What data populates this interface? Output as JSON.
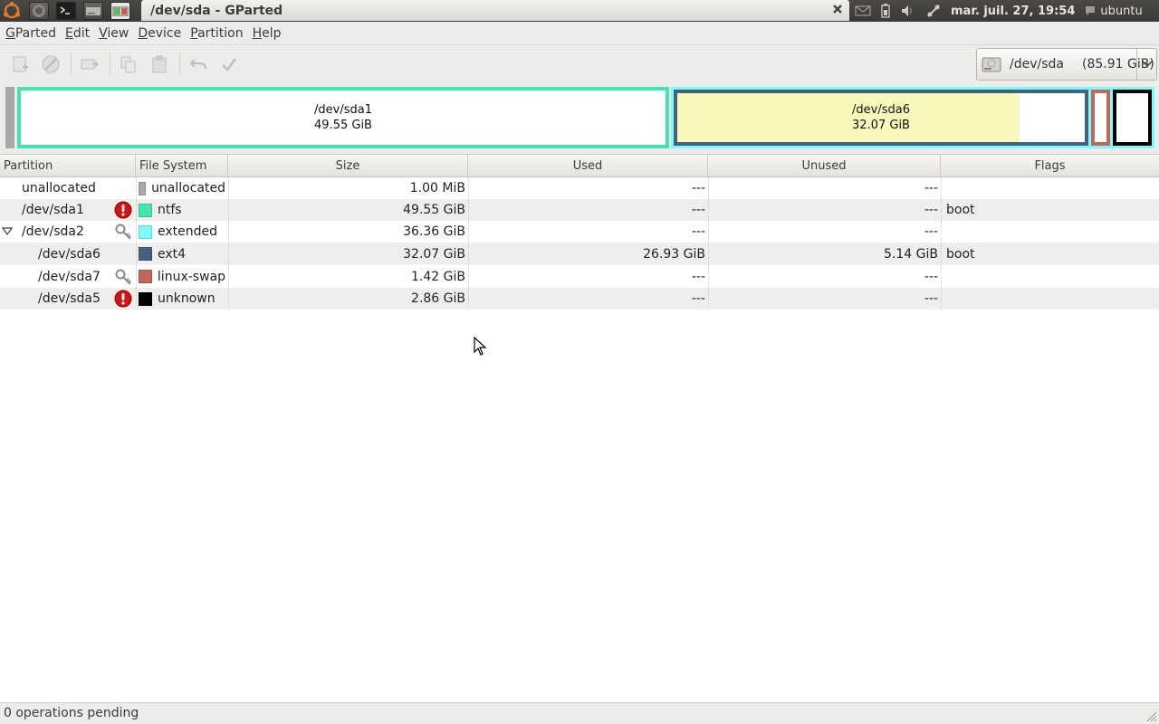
{
  "panel": {
    "window_title": "/dev/sda - GParted",
    "clock": "mar. juil. 27, 19:54",
    "user": "ubuntu"
  },
  "menubar": {
    "items": [
      {
        "label_mn": "G",
        "label_rest": "Parted"
      },
      {
        "label_mn": "E",
        "label_rest": "dit"
      },
      {
        "label_mn": "V",
        "label_rest": "iew"
      },
      {
        "label_mn": "D",
        "label_rest": "evice"
      },
      {
        "label_mn": "P",
        "label_rest": "artition"
      },
      {
        "label_mn": "H",
        "label_rest": "elp"
      }
    ]
  },
  "toolbar": {
    "device": "/dev/sda",
    "device_size": "(85.91 GiB)"
  },
  "disk_graphic": {
    "sda1": {
      "name": "/dev/sda1",
      "size": "49.55 GiB",
      "color": "#42e5ac"
    },
    "sda6": {
      "name": "/dev/sda6",
      "size": "32.07 GiB",
      "color": "#44617f"
    },
    "extended_color": "#7dfcfe",
    "swap_color": "#c1665a",
    "unknown_color": "#000000",
    "used_fill": "#f8f8ba"
  },
  "table": {
    "headers": {
      "partition": "Partition",
      "filesystem": "File System",
      "size": "Size",
      "used": "Used",
      "unused": "Unused",
      "flags": "Flags"
    },
    "rows": [
      {
        "partition": "unallocated",
        "fs": "unallocated",
        "size": "1.00 MiB",
        "used": "---",
        "unused": "---",
        "flags": "",
        "color": "#a9a9a9"
      },
      {
        "partition": "/dev/sda1",
        "fs": "ntfs",
        "size": "49.55 GiB",
        "used": "---",
        "unused": "---",
        "flags": "boot",
        "color": "#42e5ac"
      },
      {
        "partition": "/dev/sda2",
        "fs": "extended",
        "size": "36.36 GiB",
        "used": "---",
        "unused": "---",
        "flags": "",
        "color": "#7dfcfe"
      },
      {
        "partition": "/dev/sda6",
        "fs": "ext4",
        "size": "32.07 GiB",
        "used": "26.93 GiB",
        "unused": "5.14 GiB",
        "flags": "boot",
        "color": "#44617f"
      },
      {
        "partition": "/dev/sda7",
        "fs": "linux-swap",
        "size": "1.42 GiB",
        "used": "---",
        "unused": "---",
        "flags": "",
        "color": "#c1665a"
      },
      {
        "partition": "/dev/sda5",
        "fs": "unknown",
        "size": "2.86 GiB",
        "used": "---",
        "unused": "---",
        "flags": "",
        "color": "#000000"
      }
    ]
  },
  "statusbar": {
    "text": "0 operations pending"
  }
}
